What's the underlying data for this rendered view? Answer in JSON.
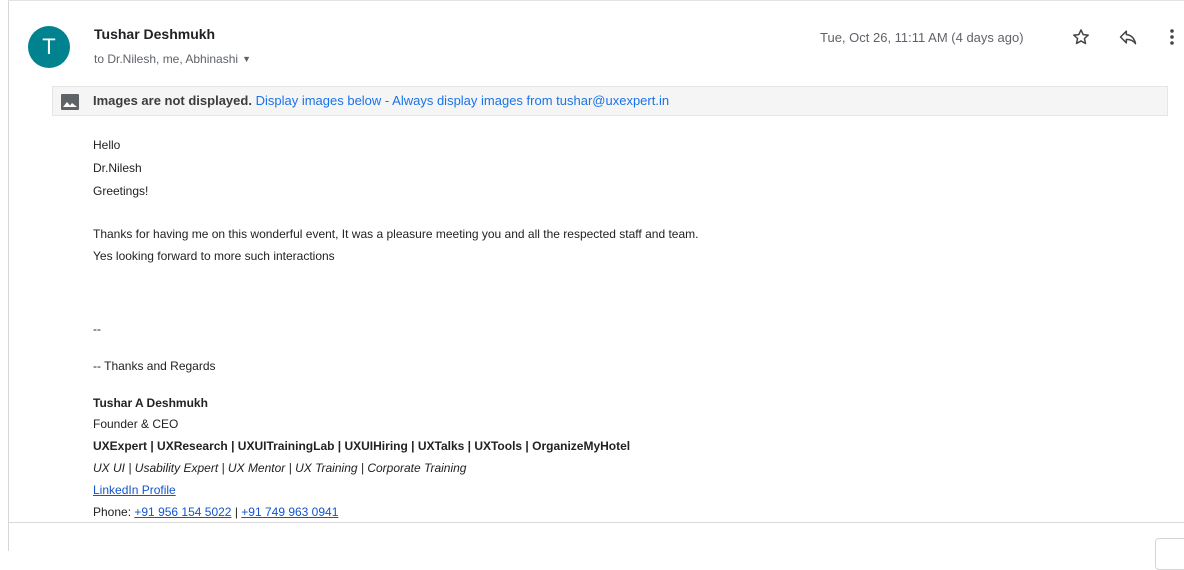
{
  "header": {
    "avatar_letter": "T",
    "sender": "Tushar Deshmukh",
    "recipients": "to Dr.Nilesh, me, Abhinashi",
    "date": "Tue, Oct 26, 11:11 AM (4 days ago)",
    "icons": [
      "star-icon",
      "reply-icon",
      "more-vert-icon"
    ],
    "avatar_color": "#00838f"
  },
  "banner": {
    "bold": "Images are not displayed.",
    "display_below": "Display images below",
    "separator": " - ",
    "always_display": "Always display images from tushar@uxexpert.in"
  },
  "message": {
    "greeting": "Hello",
    "name": "Dr.Nilesh",
    "greetings": "Greetings!",
    "para1": "Thanks for having me on this wonderful event, It was a pleasure meeting you and all the respected staff and team.",
    "para2": "Yes looking forward to more such interactions",
    "sig_sep": "--",
    "thanks": "-- Thanks and Regards",
    "sig_name": "Tushar A Deshmukh",
    "sig_title": "Founder & CEO",
    "sig_companies": "UXExpert | UXResearch | UXUITrainingLab | UXUIHiring | UXTalks | UXTools | OrganizeMyHotel",
    "sig_roles": "UX UI | Usability Expert | UX Mentor | UX Training | Corporate Training",
    "linkedin": "LinkedIn Profile",
    "phone_label": "Phone: ",
    "phone1": "+91 956 154 5022",
    "phone_sep": " | ",
    "phone2": "+91 749 963 0941"
  },
  "colors": {
    "link": "#1155cc",
    "banner_link": "#1a73e8",
    "secondary_text": "#5f6368"
  }
}
